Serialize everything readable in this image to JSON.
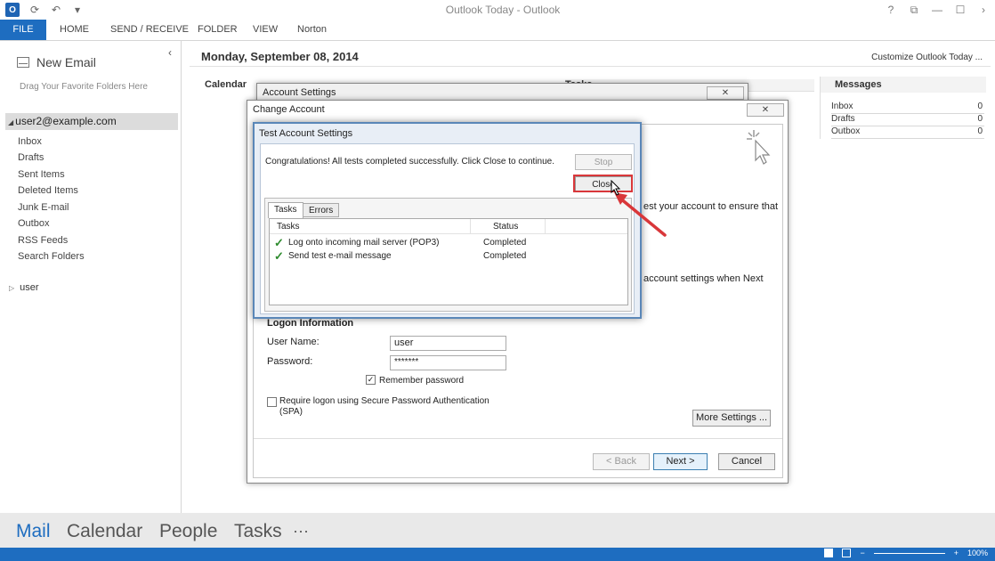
{
  "window": {
    "title": "Outlook Today - Outlook",
    "controls": [
      "?",
      "⧉",
      "—",
      "☐",
      "›"
    ]
  },
  "ribbon": {
    "tabs": [
      "FILE",
      "HOME",
      "SEND / RECEIVE",
      "FOLDER",
      "VIEW",
      "Norton"
    ]
  },
  "leftnav": {
    "new_email": "New Email",
    "collapse": "‹",
    "drag_hint": "Drag Your Favorite Folders Here",
    "account": "user2@example.com",
    "folders": [
      "Inbox",
      "Drafts",
      "Sent Items",
      "Deleted Items",
      "Junk E-mail",
      "Outbox",
      "RSS Feeds",
      "Search Folders"
    ],
    "user_group": "user"
  },
  "main": {
    "date": "Monday, September 08, 2014",
    "customize": "Customize Outlook Today ...",
    "calendar_head": "Calendar",
    "tasks_head": "Tasks",
    "messages_head": "Messages",
    "messages": [
      {
        "name": "Inbox",
        "count": "0"
      },
      {
        "name": "Drafts",
        "count": "0"
      },
      {
        "name": "Outbox",
        "count": "0"
      }
    ]
  },
  "account_settings": {
    "title": "Account Settings",
    "close": "✕"
  },
  "change_account": {
    "title": "Change Account",
    "close": "✕",
    "test_text": "est your account to ensure that",
    "settings_text": "account settings when Next",
    "logon_head": "Logon Information",
    "username_label": "User Name:",
    "username_value": "user",
    "password_label": "Password:",
    "password_value": "*******",
    "remember_label": "Remember password",
    "spa_label": "Require logon using Secure Password Authentication (SPA)",
    "more_settings": "More Settings ...",
    "back": "< Back",
    "next": "Next >",
    "cancel": "Cancel"
  },
  "test_dialog": {
    "title": "Test Account Settings",
    "message": "Congratulations! All tests completed successfully. Click Close to continue.",
    "stop": "Stop",
    "close": "Close",
    "tabs": [
      "Tasks",
      "Errors"
    ],
    "columns": [
      "Tasks",
      "Status"
    ],
    "rows": [
      {
        "task": "Log onto incoming mail server (POP3)",
        "status": "Completed"
      },
      {
        "task": "Send test e-mail message",
        "status": "Completed"
      }
    ]
  },
  "bottomnav": {
    "items": [
      "Mail",
      "Calendar",
      "People",
      "Tasks",
      "···"
    ],
    "active_color": "#1e6dc0"
  },
  "statusbar": {
    "zoom": "100%"
  },
  "colors": {
    "accent": "#1e6dc0",
    "highlight": "#d9373a"
  }
}
